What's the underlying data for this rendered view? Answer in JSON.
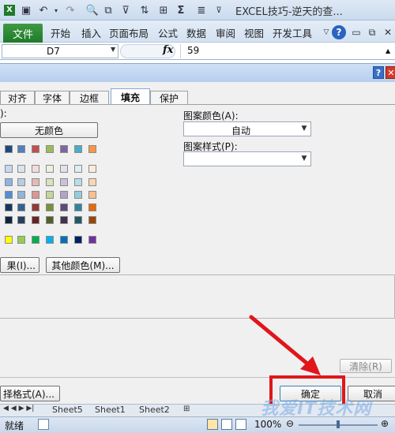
{
  "window": {
    "title": "EXCEL技巧-逆天的查..."
  },
  "ribbon": {
    "file_tab": "文件",
    "tabs": [
      "开始",
      "插入",
      "页面布局",
      "公式",
      "数据",
      "审阅",
      "视图",
      "开发工具"
    ]
  },
  "formula_bar": {
    "name_box": "D7",
    "fx_label": "fx",
    "value": "59"
  },
  "dialog": {
    "tabs": [
      "对齐",
      "字体",
      "边框",
      "填充",
      "保护"
    ],
    "active_tab": "填充",
    "left_label": "):",
    "no_color": "无颜色",
    "fill_effects": "果(I)...",
    "more_colors": "其他颜色(M)...",
    "pattern_color_label": "图案颜色(A):",
    "pattern_color_value": "自动",
    "pattern_style_label": "图案样式(P):",
    "pattern_style_value": "",
    "clear_button": "清除(R)",
    "format_button": "择格式(A)...",
    "ok_button": "确定",
    "cancel_button": "取消"
  },
  "sheet_tabs": [
    "Sheet5",
    "Sheet1",
    "Sheet2"
  ],
  "status": {
    "ready": "就绪",
    "zoom": "100%"
  },
  "watermark": "我爱IT技术网",
  "colors": {
    "theme_row": [
      "#ffffff",
      "#000000",
      "#eeece1",
      "#1f497d",
      "#4f81bd",
      "#c0504d",
      "#9bbb59",
      "#8064a2",
      "#4bacc6",
      "#f79646"
    ],
    "tint_rows": [
      [
        "#f2f2f2",
        "#7f7f7f",
        "#ddd9c3",
        "#c6d9f0",
        "#dbe5f1",
        "#f2dcdb",
        "#ebf1dd",
        "#e5e0ec",
        "#dbeef3",
        "#fdeada"
      ],
      [
        "#d8d8d8",
        "#595959",
        "#c4bd97",
        "#8db3e2",
        "#b8cce4",
        "#e5b9b7",
        "#d7e3bc",
        "#ccc1d9",
        "#b7dde8",
        "#fbd5b5"
      ],
      [
        "#bfbfbf",
        "#3f3f3f",
        "#938953",
        "#548dd4",
        "#95b3d7",
        "#d99694",
        "#c3d69b",
        "#b2a2c7",
        "#92cddc",
        "#fac08f"
      ],
      [
        "#a5a5a5",
        "#262626",
        "#494429",
        "#17365d",
        "#366092",
        "#953734",
        "#76923c",
        "#5f497a",
        "#31859b",
        "#e36c09"
      ],
      [
        "#7f7f7f",
        "#0c0c0c",
        "#1d1b10",
        "#0f243e",
        "#244061",
        "#632423",
        "#4f6128",
        "#3f3151",
        "#205867",
        "#974806"
      ]
    ],
    "standard_row": [
      "#c00000",
      "#ff0000",
      "#ffc000",
      "#ffff00",
      "#92d050",
      "#00b050",
      "#00b0f0",
      "#0070c0",
      "#002060",
      "#7030a0"
    ],
    "accent_red": "#e0161b"
  }
}
